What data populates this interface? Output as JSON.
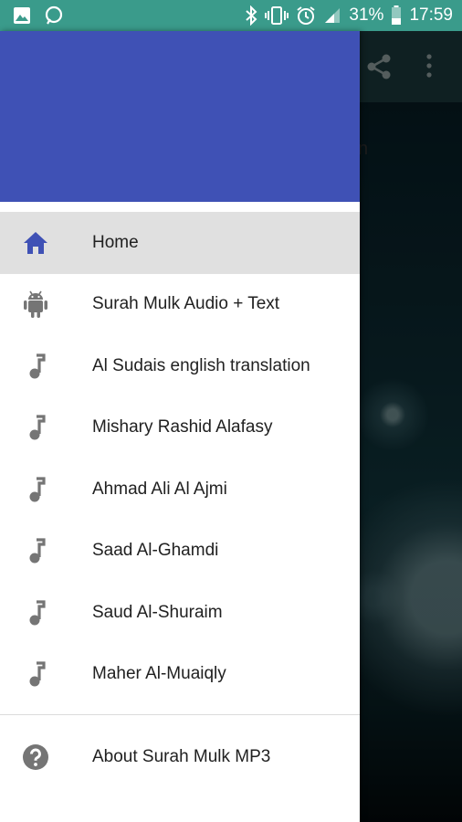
{
  "status_bar": {
    "battery_percent": "31%",
    "time": "17:59",
    "left_icons": [
      "gallery-icon",
      "chat-bubble-icon"
    ],
    "right_icons": [
      "bluetooth-icon",
      "vibrate-icon",
      "alarm-icon",
      "signal-icon",
      "battery-icon"
    ]
  },
  "background_app": {
    "toolbar_icons": [
      "share-icon",
      "more-vert-icon"
    ],
    "partial_text": "n"
  },
  "drawer": {
    "header_color": "#3f51b5",
    "items": [
      {
        "label": "Home",
        "icon": "home-icon",
        "active": true
      },
      {
        "label": "Surah Mulk Audio + Text",
        "icon": "android-icon"
      },
      {
        "label": "Al Sudais english translation",
        "icon": "music-note-icon"
      },
      {
        "label": "Mishary Rashid Alafasy",
        "icon": "music-note-icon"
      },
      {
        "label": "Ahmad Ali Al Ajmi",
        "icon": "music-note-icon"
      },
      {
        "label": "Saad Al-Ghamdi",
        "icon": "music-note-icon"
      },
      {
        "label": "Saud Al-Shuraim",
        "icon": "music-note-icon"
      },
      {
        "label": "Maher Al-Muaiqly",
        "icon": "music-note-icon"
      }
    ],
    "footer_item": {
      "label": "About Surah Mulk MP3",
      "icon": "help-icon"
    }
  },
  "colors": {
    "status_bar": "#3a9b8b",
    "accent": "#3f51b5",
    "active_row": "#e0e0e0",
    "icon_grey": "#757575"
  }
}
